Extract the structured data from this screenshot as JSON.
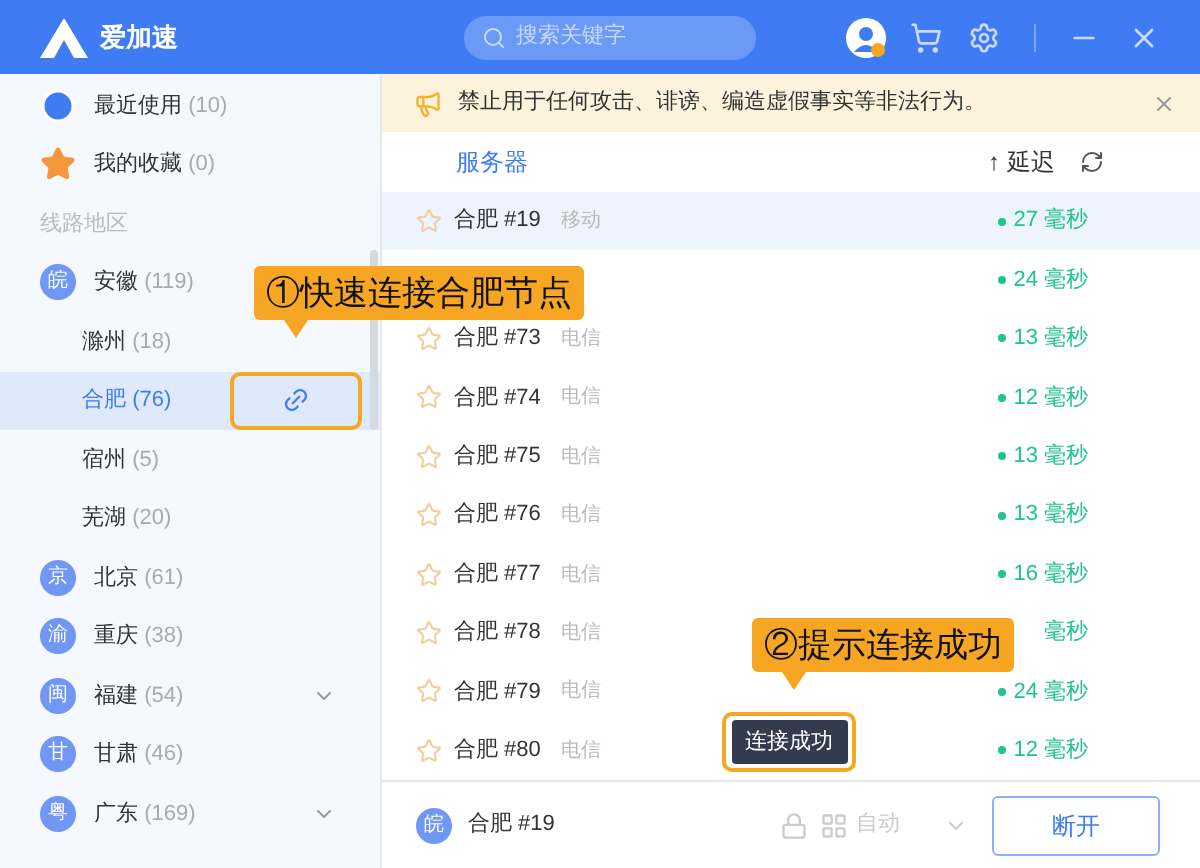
{
  "header": {
    "app_name": "爱加速",
    "search": {
      "placeholder": "搜索关键字"
    }
  },
  "sidebar": {
    "shortcuts": [
      {
        "kind": "recent",
        "label": "最近使用",
        "count": "(10)"
      },
      {
        "kind": "favorite",
        "label": "我的收藏",
        "count": "(0)"
      }
    ],
    "section_label": "线路地区",
    "regions": [
      {
        "badge": "皖",
        "label": "安徽",
        "count": "(119)",
        "collapsible": false,
        "children": [
          {
            "label": "滁州",
            "count": "(18)",
            "selected": false
          },
          {
            "label": "合肥",
            "count": "(76)",
            "selected": true
          },
          {
            "label": "宿州",
            "count": "(5)",
            "selected": false
          },
          {
            "label": "芜湖",
            "count": "(20)",
            "selected": false
          }
        ]
      },
      {
        "badge": "京",
        "label": "北京",
        "count": "(61)",
        "collapsible": false
      },
      {
        "badge": "渝",
        "label": "重庆",
        "count": "(38)",
        "collapsible": false
      },
      {
        "badge": "闽",
        "label": "福建",
        "count": "(54)",
        "collapsible": true
      },
      {
        "badge": "甘",
        "label": "甘肃",
        "count": "(46)",
        "collapsible": false
      },
      {
        "badge": "粤",
        "label": "广东",
        "count": "(169)",
        "collapsible": true
      }
    ]
  },
  "notice": "禁止用于任何攻击、诽谤、编造虚假事实等非法行为。",
  "table": {
    "columns": [
      "服务器",
      "↑ 延迟"
    ],
    "rows": [
      {
        "name": "合肥 #19",
        "carrier": "移动",
        "latency": "27 毫秒",
        "signal": true,
        "selected": true
      },
      {
        "latency": "24 毫秒",
        "signal": true,
        "selected": false
      },
      {
        "name": "合肥 #73",
        "carrier": "电信",
        "latency": "13 毫秒",
        "signal": true,
        "selected": false
      },
      {
        "name": "合肥 #74",
        "carrier": "电信",
        "latency": "12 毫秒",
        "signal": true,
        "selected": false
      },
      {
        "name": "合肥 #75",
        "carrier": "电信",
        "latency": "13 毫秒",
        "signal": true,
        "selected": false
      },
      {
        "name": "合肥 #76",
        "carrier": "电信",
        "latency": "13 毫秒",
        "signal": true,
        "selected": false
      },
      {
        "name": "合肥 #77",
        "carrier": "电信",
        "latency": "16 毫秒",
        "signal": true,
        "selected": false
      },
      {
        "name": "合肥 #78",
        "carrier": "电信",
        "latency": "毫秒",
        "signal": false,
        "selected": false
      },
      {
        "name": "合肥 #79",
        "carrier": "电信",
        "latency": "24 毫秒",
        "signal": true,
        "selected": false
      },
      {
        "name": "合肥 #80",
        "carrier": "电信",
        "latency": "12 毫秒",
        "signal": true,
        "selected": false
      }
    ]
  },
  "bottom_bar": {
    "badge": "皖",
    "server": "合肥 #19",
    "mode": "自动",
    "button": "断开"
  },
  "toast": "连接成功",
  "annotations": [
    "①快速连接合肥节点",
    "②提示连接成功"
  ]
}
